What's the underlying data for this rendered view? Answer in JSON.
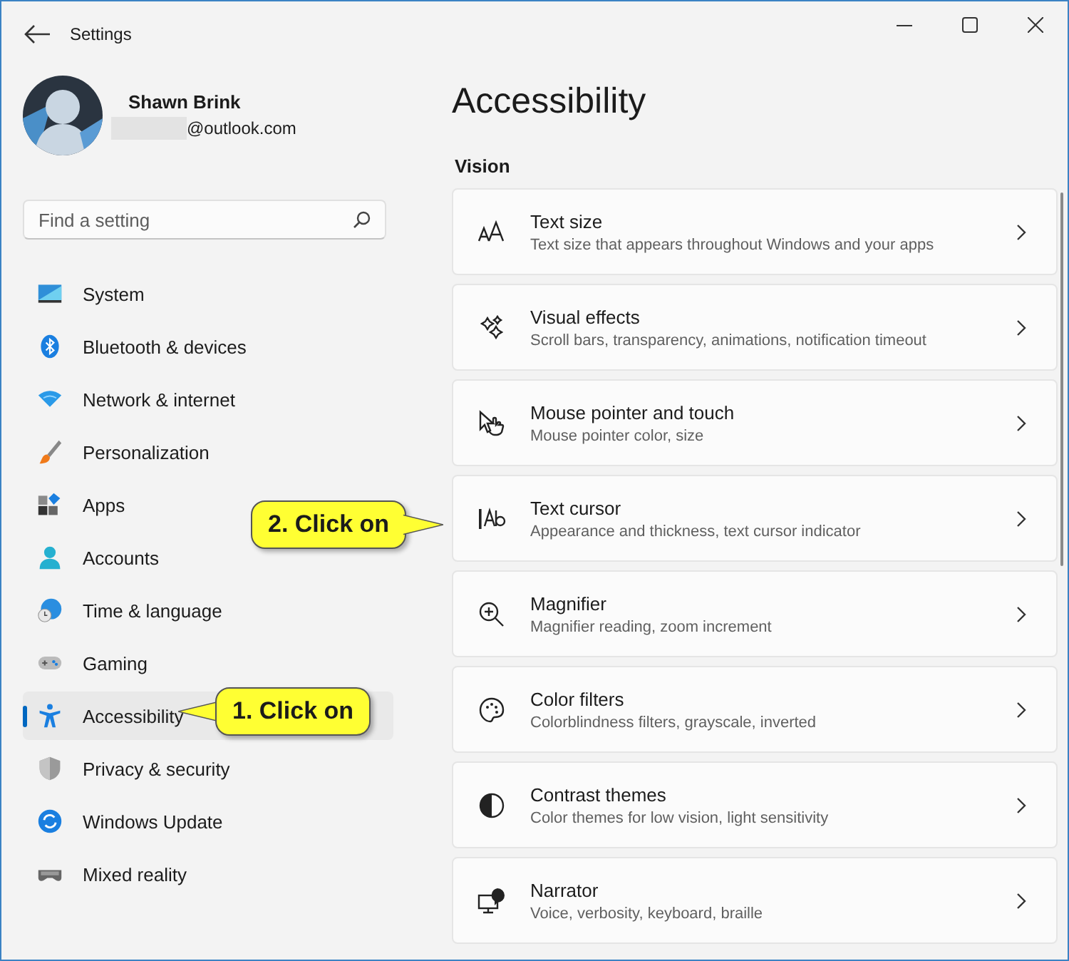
{
  "window": {
    "title": "Settings"
  },
  "profile": {
    "name": "Shawn Brink",
    "email": "@outlook.com"
  },
  "search": {
    "placeholder": "Find a setting"
  },
  "nav": [
    {
      "label": "System",
      "selected": false
    },
    {
      "label": "Bluetooth & devices",
      "selected": false
    },
    {
      "label": "Network & internet",
      "selected": false
    },
    {
      "label": "Personalization",
      "selected": false
    },
    {
      "label": "Apps",
      "selected": false
    },
    {
      "label": "Accounts",
      "selected": false
    },
    {
      "label": "Time & language",
      "selected": false
    },
    {
      "label": "Gaming",
      "selected": false
    },
    {
      "label": "Accessibility",
      "selected": true
    },
    {
      "label": "Privacy & security",
      "selected": false
    },
    {
      "label": "Windows Update",
      "selected": false
    },
    {
      "label": "Mixed reality",
      "selected": false
    }
  ],
  "page": {
    "title": "Accessibility",
    "section": "Vision"
  },
  "cards": [
    {
      "title": "Text size",
      "description": "Text size that appears throughout Windows and your apps"
    },
    {
      "title": "Visual effects",
      "description": "Scroll bars, transparency, animations, notification timeout"
    },
    {
      "title": "Mouse pointer and touch",
      "description": "Mouse pointer color, size"
    },
    {
      "title": "Text cursor",
      "description": "Appearance and thickness, text cursor indicator"
    },
    {
      "title": "Magnifier",
      "description": "Magnifier reading, zoom increment"
    },
    {
      "title": "Color filters",
      "description": "Colorblindness filters, grayscale, inverted"
    },
    {
      "title": "Contrast themes",
      "description": "Color themes for low vision, light sensitivity"
    },
    {
      "title": "Narrator",
      "description": "Voice, verbosity, keyboard, braille"
    }
  ],
  "callouts": [
    {
      "text": "2. Click on"
    },
    {
      "text": "1. Click on"
    }
  ]
}
